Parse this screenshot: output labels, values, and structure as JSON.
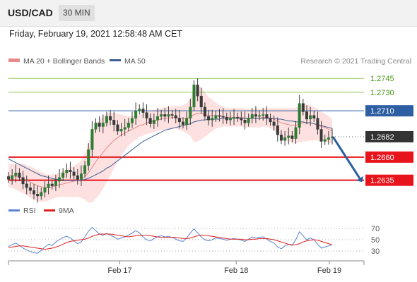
{
  "header": {
    "symbol": "USD/CAD",
    "timeframe": "30 MIN",
    "timestamp": "Friday, February 19, 2021 12:58:48 AM CET"
  },
  "legend": {
    "ma20": "MA 20 + Bollinger Bands",
    "ma50": "MA 50",
    "rsi": "RSI",
    "rsi_ma": "9MA"
  },
  "credit": "Research © 2021 Trading Central",
  "colors": {
    "ma20": "#e88a8a",
    "ma50": "#3d5f95",
    "bands_fill": "#fde0e0",
    "candle": "#3a3a3a",
    "up_candle": "#2e7d32",
    "support": "#e8141c",
    "resistance_green": "#8dc75a",
    "resistance_blue": "#2e5fa3",
    "current": "#333333",
    "arrow": "#2a5f9e",
    "rsi": "#5b83cf",
    "rsi_ma": "#e02020"
  },
  "chart_data": [
    {
      "type": "candlestick",
      "title": "USD/CAD 30 MIN",
      "x_labels": [
        "Feb 17",
        "Feb 18",
        "Feb 19"
      ],
      "ylim": [
        1.2618,
        1.2752
      ],
      "levels": [
        {
          "value": "1.2745",
          "kind": "resistance",
          "color": "#8dc75a"
        },
        {
          "value": "1.2730",
          "kind": "resistance",
          "color": "#8dc75a"
        },
        {
          "value": "1.2710",
          "kind": "resistance",
          "color": "#2e5fa3"
        },
        {
          "value": "1.2682",
          "kind": "current",
          "color": "#333333"
        },
        {
          "value": "1.2660",
          "kind": "support",
          "color": "#e8141c"
        },
        {
          "value": "1.2635",
          "kind": "support",
          "color": "#e8141c"
        }
      ],
      "close": [
        1.2636,
        1.264,
        1.2643,
        1.2638,
        1.2631,
        1.2627,
        1.2624,
        1.262,
        1.2618,
        1.2622,
        1.2627,
        1.2631,
        1.2629,
        1.2634,
        1.2638,
        1.2643,
        1.2646,
        1.2644,
        1.264,
        1.2636,
        1.2642,
        1.2651,
        1.2668,
        1.269,
        1.2697,
        1.2693,
        1.2697,
        1.2704,
        1.27,
        1.2695,
        1.2688,
        1.269,
        1.2692,
        1.2697,
        1.2702,
        1.271,
        1.2712,
        1.2708,
        1.2702,
        1.2696,
        1.27,
        1.2704,
        1.2706,
        1.2704,
        1.2706,
        1.2705,
        1.2702,
        1.2698,
        1.2695,
        1.2702,
        1.2714,
        1.2738,
        1.2726,
        1.2714,
        1.2704,
        1.27,
        1.2702,
        1.2705,
        1.2704,
        1.2703,
        1.27,
        1.2702,
        1.2703,
        1.2702,
        1.27,
        1.2697,
        1.2702,
        1.2706,
        1.2704,
        1.2705,
        1.2706,
        1.2702,
        1.2698,
        1.2694,
        1.2684,
        1.2678,
        1.2681,
        1.2683,
        1.268,
        1.2692,
        1.2718,
        1.2709,
        1.2701,
        1.2705,
        1.2702,
        1.269,
        1.2677,
        1.2679,
        1.2681,
        1.2682
      ],
      "ma20": [
        1.264,
        1.264,
        1.2639,
        1.2638,
        1.2637,
        1.2635,
        1.2633,
        1.2631,
        1.2629,
        1.2628,
        1.2627,
        1.2627,
        1.2628,
        1.2629,
        1.263,
        1.2631,
        1.2632,
        1.2633,
        1.2634,
        1.2635,
        1.2636,
        1.2639,
        1.2643,
        1.2649,
        1.2655,
        1.266,
        1.2665,
        1.267,
        1.2674,
        1.2678,
        1.2681,
        1.2684,
        1.2686,
        1.2688,
        1.269,
        1.2692,
        1.2694,
        1.2695,
        1.2697,
        1.2698,
        1.2699,
        1.27,
        1.2701,
        1.2702,
        1.2702,
        1.2703,
        1.2703,
        1.2702,
        1.2702,
        1.2702,
        1.2703,
        1.2706,
        1.2707,
        1.2707,
        1.2706,
        1.2705,
        1.2705,
        1.2705,
        1.2704,
        1.2704,
        1.2703,
        1.2703,
        1.2703,
        1.2703,
        1.2703,
        1.2702,
        1.2702,
        1.2702,
        1.2702,
        1.2702,
        1.2703,
        1.2703,
        1.2702,
        1.2701,
        1.2699,
        1.2697,
        1.2696,
        1.2695,
        1.2694,
        1.2694,
        1.2696,
        1.2697,
        1.2697,
        1.2697,
        1.2696,
        1.2695,
        1.2693,
        1.2692,
        1.269,
        1.2688
      ],
      "ma50": [
        1.2658,
        1.2656,
        1.2654,
        1.2652,
        1.265,
        1.2648,
        1.2646,
        1.2644,
        1.2642,
        1.264,
        1.2639,
        1.2638,
        1.2637,
        1.2636,
        1.2636,
        1.2635,
        1.2635,
        1.2635,
        1.2635,
        1.2635,
        1.2635,
        1.2636,
        1.2637,
        1.2639,
        1.2641,
        1.2643,
        1.2645,
        1.2648,
        1.265,
        1.2653,
        1.2656,
        1.2659,
        1.2662,
        1.2665,
        1.2668,
        1.2671,
        1.2674,
        1.2677,
        1.2679,
        1.2681,
        1.2683,
        1.2685,
        1.2687,
        1.2689,
        1.269,
        1.2691,
        1.2692,
        1.2693,
        1.2694,
        1.2695,
        1.2696,
        1.2698,
        1.2699,
        1.27,
        1.27,
        1.2701,
        1.2701,
        1.2701,
        1.2701,
        1.2702,
        1.2702,
        1.2702,
        1.2702,
        1.2702,
        1.2702,
        1.2702,
        1.2702,
        1.2702,
        1.2702,
        1.2702,
        1.2702,
        1.2702,
        1.2702,
        1.2702,
        1.2701,
        1.2701,
        1.27,
        1.2699,
        1.2699,
        1.2698,
        1.2698,
        1.2698,
        1.2697,
        1.2697,
        1.2696,
        1.2695,
        1.2694,
        1.2693,
        1.2692,
        1.2691
      ],
      "bb_half_width": [
        0.0012,
        0.0013,
        0.0014,
        0.0015,
        0.0016,
        0.0016,
        0.0017,
        0.0017,
        0.0017,
        0.0016,
        0.0015,
        0.0014,
        0.0013,
        0.0013,
        0.0013,
        0.0014,
        0.0015,
        0.0016,
        0.0017,
        0.0018,
        0.002,
        0.0025,
        0.0032,
        0.0038,
        0.004,
        0.004,
        0.0039,
        0.0037,
        0.0034,
        0.003,
        0.0026,
        0.0022,
        0.0019,
        0.0016,
        0.0014,
        0.0013,
        0.0012,
        0.0012,
        0.0012,
        0.0012,
        0.0012,
        0.0012,
        0.0012,
        0.0012,
        0.0012,
        0.0012,
        0.0012,
        0.0013,
        0.0014,
        0.0016,
        0.002,
        0.003,
        0.003,
        0.0028,
        0.0024,
        0.002,
        0.0017,
        0.0014,
        0.0012,
        0.0011,
        0.001,
        0.001,
        0.001,
        0.001,
        0.001,
        0.001,
        0.001,
        0.001,
        0.001,
        0.001,
        0.001,
        0.001,
        0.0011,
        0.0012,
        0.0014,
        0.0016,
        0.0017,
        0.0018,
        0.0019,
        0.0019,
        0.002,
        0.002,
        0.002,
        0.0019,
        0.0018,
        0.0017,
        0.0016,
        0.0015,
        0.0014,
        0.0013
      ]
    },
    {
      "type": "line",
      "title": "RSI",
      "ylim": [
        20,
        80
      ],
      "yticks": [
        "70",
        "50",
        "30"
      ],
      "series": [
        {
          "name": "RSI",
          "values": [
            38,
            41,
            44,
            40,
            35,
            32,
            29,
            27,
            26,
            31,
            37,
            42,
            40,
            46,
            50,
            54,
            56,
            53,
            48,
            43,
            46,
            55,
            65,
            72,
            66,
            60,
            58,
            61,
            58,
            55,
            51,
            53,
            55,
            58,
            62,
            66,
            62,
            55,
            50,
            48,
            52,
            55,
            57,
            55,
            56,
            54,
            51,
            48,
            47,
            53,
            62,
            69,
            62,
            55,
            50,
            48,
            50,
            53,
            52,
            51,
            49,
            51,
            52,
            51,
            49,
            47,
            51,
            55,
            53,
            54,
            55,
            51,
            47,
            44,
            37,
            34,
            39,
            42,
            40,
            50,
            64,
            57,
            50,
            53,
            50,
            42,
            35,
            37,
            39,
            41
          ]
        },
        {
          "name": "9MA",
          "values": [
            36,
            37,
            38,
            39,
            39,
            38,
            37,
            36,
            35,
            34,
            33,
            34,
            35,
            37,
            39,
            42,
            45,
            47,
            48,
            49,
            50,
            51,
            53,
            56,
            58,
            60,
            60,
            60,
            60,
            59,
            58,
            57,
            56,
            55,
            56,
            57,
            58,
            58,
            58,
            57,
            56,
            55,
            54,
            54,
            54,
            54,
            54,
            53,
            52,
            52,
            53,
            55,
            57,
            58,
            58,
            57,
            56,
            55,
            54,
            53,
            52,
            51,
            51,
            51,
            51,
            50,
            50,
            51,
            51,
            52,
            52,
            52,
            51,
            50,
            48,
            46,
            44,
            42,
            41,
            41,
            43,
            46,
            48,
            49,
            50,
            49,
            47,
            45,
            43,
            41
          ]
        }
      ]
    }
  ]
}
